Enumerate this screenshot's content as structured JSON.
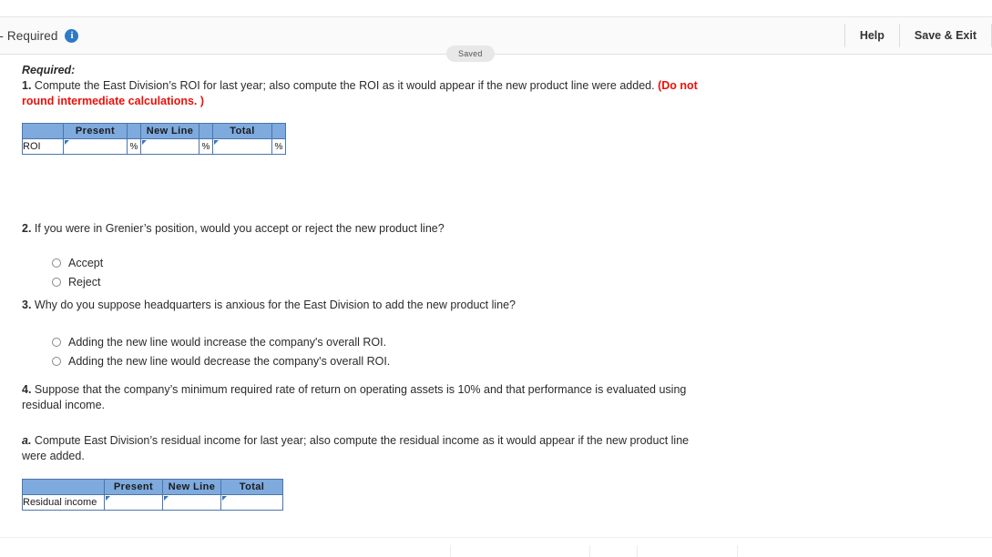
{
  "header": {
    "title": "signment - Required",
    "info_icon": "info-circle-icon",
    "saved_badge": "Saved",
    "help_label": "Help",
    "save_exit_label": "Save & Exit"
  },
  "content": {
    "required_label": "Required:",
    "q1": {
      "number": "1.",
      "text": " Compute the East Division’s ROI for last year; also compute the ROI as it would appear if the new product line were added. ",
      "note": "(Do not round intermediate calculations. )"
    },
    "roi_table": {
      "corner_header": "",
      "columns": [
        "Present",
        "New Line",
        "Total"
      ],
      "row_label": "ROI",
      "values": [
        "",
        "",
        ""
      ],
      "unit": "%"
    },
    "q2": {
      "number": "2.",
      "text": " If you were in Grenier’s position, would you accept or reject the new product line?",
      "options": [
        "Accept",
        "Reject"
      ]
    },
    "q3": {
      "number": "3.",
      "text": " Why do you suppose headquarters is anxious for the East Division to add the new product line?",
      "options": [
        "Adding the new line would increase the company's overall ROI.",
        "Adding the new line would decrease the company's overall ROI."
      ]
    },
    "q4": {
      "number": "4.",
      "text": " Suppose that the company’s minimum required rate of return on operating assets is 10% and that performance is evaluated using residual income."
    },
    "q4a": {
      "number": "a.",
      "text": " Compute East Division’s residual income for last year; also compute the residual income as it would appear if the new product line were added."
    },
    "ri_table": {
      "corner_header": "",
      "columns": [
        "Present",
        "New Line",
        "Total"
      ],
      "row_label": "Residual income",
      "values": [
        "",
        "",
        ""
      ]
    }
  },
  "colors": {
    "header_blue": "#7eaade",
    "table_border": "#4b75ad",
    "accent_red": "#e8120b",
    "info_blue": "#2e7ac4"
  }
}
